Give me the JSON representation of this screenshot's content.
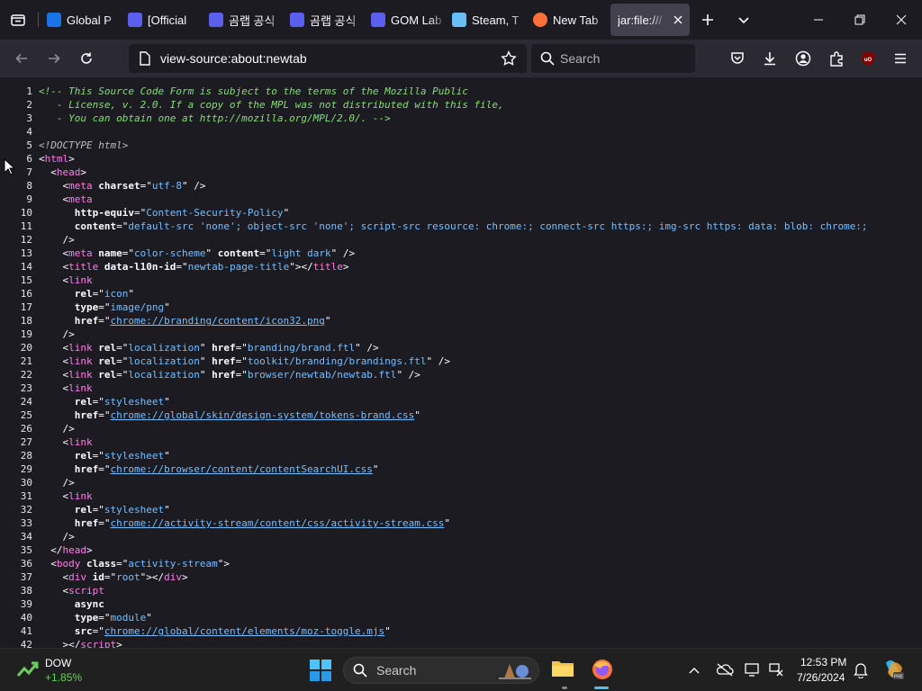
{
  "tabs": [
    {
      "title": "Global P",
      "icon": "edge-icon",
      "color": "#1a73e8"
    },
    {
      "title": "[Official",
      "icon": "gomlab-icon",
      "color": "#5b5fef"
    },
    {
      "title": "곰랩 공식",
      "icon": "gomlab-icon",
      "color": "#5b5fef"
    },
    {
      "title": "곰랩 공식",
      "icon": "gomlab-icon",
      "color": "#5b5fef"
    },
    {
      "title": "GOM Lab",
      "icon": "gomlab-icon",
      "color": "#5b5fef"
    },
    {
      "title": "Steam, T",
      "icon": "steam-icon",
      "color": "#66c0f4"
    },
    {
      "title": "New Tab",
      "icon": "firefox-icon",
      "color": "#ff7139"
    },
    {
      "title": "jar:file:///",
      "icon": "",
      "active": true
    }
  ],
  "nav": {
    "url": "view-source:about:newtab",
    "search_placeholder": "Search"
  },
  "source_lines": [
    [
      [
        "cm",
        "<!-- This Source Code Form is subject to the terms of the Mozilla Public"
      ]
    ],
    [
      [
        "cm",
        "   - License, v. 2.0. If a copy of the MPL was not distributed with this file,"
      ]
    ],
    [
      [
        "cm",
        "   - You can obtain one at http://mozilla.org/MPL/2.0/. -->"
      ]
    ],
    [],
    [
      [
        "dt",
        "<!DOCTYPE html>"
      ]
    ],
    [
      [
        "tx",
        "<"
      ],
      [
        "tg",
        "html"
      ],
      [
        "tx",
        ">"
      ]
    ],
    [
      [
        "tx",
        "  <"
      ],
      [
        "tg",
        "head"
      ],
      [
        "tx",
        ">"
      ]
    ],
    [
      [
        "tx",
        "    <"
      ],
      [
        "tg",
        "meta"
      ],
      [
        "tx",
        " "
      ],
      [
        "at",
        "charset"
      ],
      [
        "tx",
        "=\""
      ],
      [
        "av",
        "utf-8"
      ],
      [
        "tx",
        "\" />"
      ]
    ],
    [
      [
        "tx",
        "    <"
      ],
      [
        "tg",
        "meta"
      ]
    ],
    [
      [
        "tx",
        "      "
      ],
      [
        "at",
        "http-equiv"
      ],
      [
        "tx",
        "=\""
      ],
      [
        "av",
        "Content-Security-Policy"
      ],
      [
        "tx",
        "\""
      ]
    ],
    [
      [
        "tx",
        "      "
      ],
      [
        "at",
        "content"
      ],
      [
        "tx",
        "=\""
      ],
      [
        "av",
        "default-src 'none'; object-src 'none'; script-src resource: chrome:; connect-src https:; img-src https: data: blob: chrome:;"
      ]
    ],
    [
      [
        "tx",
        "    />"
      ]
    ],
    [
      [
        "tx",
        "    <"
      ],
      [
        "tg",
        "meta"
      ],
      [
        "tx",
        " "
      ],
      [
        "at",
        "name"
      ],
      [
        "tx",
        "=\""
      ],
      [
        "av",
        "color-scheme"
      ],
      [
        "tx",
        "\" "
      ],
      [
        "at",
        "content"
      ],
      [
        "tx",
        "=\""
      ],
      [
        "av",
        "light dark"
      ],
      [
        "tx",
        "\" />"
      ]
    ],
    [
      [
        "tx",
        "    <"
      ],
      [
        "tg",
        "title"
      ],
      [
        "tx",
        " "
      ],
      [
        "at",
        "data-l10n-id"
      ],
      [
        "tx",
        "=\""
      ],
      [
        "av",
        "newtab-page-title"
      ],
      [
        "tx",
        "\"></"
      ],
      [
        "tg",
        "title"
      ],
      [
        "tx",
        ">"
      ]
    ],
    [
      [
        "tx",
        "    <"
      ],
      [
        "tg",
        "link"
      ]
    ],
    [
      [
        "tx",
        "      "
      ],
      [
        "at",
        "rel"
      ],
      [
        "tx",
        "=\""
      ],
      [
        "av",
        "icon"
      ],
      [
        "tx",
        "\""
      ]
    ],
    [
      [
        "tx",
        "      "
      ],
      [
        "at",
        "type"
      ],
      [
        "tx",
        "=\""
      ],
      [
        "av",
        "image/png"
      ],
      [
        "tx",
        "\""
      ]
    ],
    [
      [
        "tx",
        "      "
      ],
      [
        "at",
        "href"
      ],
      [
        "tx",
        "=\""
      ],
      [
        "lk",
        "chrome://branding/content/icon32.png"
      ],
      [
        "tx",
        "\""
      ]
    ],
    [
      [
        "tx",
        "    />"
      ]
    ],
    [
      [
        "tx",
        "    <"
      ],
      [
        "tg",
        "link"
      ],
      [
        "tx",
        " "
      ],
      [
        "at",
        "rel"
      ],
      [
        "tx",
        "=\""
      ],
      [
        "av",
        "localization"
      ],
      [
        "tx",
        "\" "
      ],
      [
        "at",
        "href"
      ],
      [
        "tx",
        "=\""
      ],
      [
        "av",
        "branding/brand.ftl"
      ],
      [
        "tx",
        "\" />"
      ]
    ],
    [
      [
        "tx",
        "    <"
      ],
      [
        "tg",
        "link"
      ],
      [
        "tx",
        " "
      ],
      [
        "at",
        "rel"
      ],
      [
        "tx",
        "=\""
      ],
      [
        "av",
        "localization"
      ],
      [
        "tx",
        "\" "
      ],
      [
        "at",
        "href"
      ],
      [
        "tx",
        "=\""
      ],
      [
        "av",
        "toolkit/branding/brandings.ftl"
      ],
      [
        "tx",
        "\" />"
      ]
    ],
    [
      [
        "tx",
        "    <"
      ],
      [
        "tg",
        "link"
      ],
      [
        "tx",
        " "
      ],
      [
        "at",
        "rel"
      ],
      [
        "tx",
        "=\""
      ],
      [
        "av",
        "localization"
      ],
      [
        "tx",
        "\" "
      ],
      [
        "at",
        "href"
      ],
      [
        "tx",
        "=\""
      ],
      [
        "av",
        "browser/newtab/newtab.ftl"
      ],
      [
        "tx",
        "\" />"
      ]
    ],
    [
      [
        "tx",
        "    <"
      ],
      [
        "tg",
        "link"
      ]
    ],
    [
      [
        "tx",
        "      "
      ],
      [
        "at",
        "rel"
      ],
      [
        "tx",
        "=\""
      ],
      [
        "av",
        "stylesheet"
      ],
      [
        "tx",
        "\""
      ]
    ],
    [
      [
        "tx",
        "      "
      ],
      [
        "at",
        "href"
      ],
      [
        "tx",
        "=\""
      ],
      [
        "lk",
        "chrome://global/skin/design-system/tokens-brand.css"
      ],
      [
        "tx",
        "\""
      ]
    ],
    [
      [
        "tx",
        "    />"
      ]
    ],
    [
      [
        "tx",
        "    <"
      ],
      [
        "tg",
        "link"
      ]
    ],
    [
      [
        "tx",
        "      "
      ],
      [
        "at",
        "rel"
      ],
      [
        "tx",
        "=\""
      ],
      [
        "av",
        "stylesheet"
      ],
      [
        "tx",
        "\""
      ]
    ],
    [
      [
        "tx",
        "      "
      ],
      [
        "at",
        "href"
      ],
      [
        "tx",
        "=\""
      ],
      [
        "lk",
        "chrome://browser/content/contentSearchUI.css"
      ],
      [
        "tx",
        "\""
      ]
    ],
    [
      [
        "tx",
        "    />"
      ]
    ],
    [
      [
        "tx",
        "    <"
      ],
      [
        "tg",
        "link"
      ]
    ],
    [
      [
        "tx",
        "      "
      ],
      [
        "at",
        "rel"
      ],
      [
        "tx",
        "=\""
      ],
      [
        "av",
        "stylesheet"
      ],
      [
        "tx",
        "\""
      ]
    ],
    [
      [
        "tx",
        "      "
      ],
      [
        "at",
        "href"
      ],
      [
        "tx",
        "=\""
      ],
      [
        "lk",
        "chrome://activity-stream/content/css/activity-stream.css"
      ],
      [
        "tx",
        "\""
      ]
    ],
    [
      [
        "tx",
        "    />"
      ]
    ],
    [
      [
        "tx",
        "  </"
      ],
      [
        "tg",
        "head"
      ],
      [
        "tx",
        ">"
      ]
    ],
    [
      [
        "tx",
        "  <"
      ],
      [
        "tg",
        "body"
      ],
      [
        "tx",
        " "
      ],
      [
        "at",
        "class"
      ],
      [
        "tx",
        "=\""
      ],
      [
        "av",
        "activity-stream"
      ],
      [
        "tx",
        "\">"
      ]
    ],
    [
      [
        "tx",
        "    <"
      ],
      [
        "tg",
        "div"
      ],
      [
        "tx",
        " "
      ],
      [
        "at",
        "id"
      ],
      [
        "tx",
        "=\""
      ],
      [
        "av",
        "root"
      ],
      [
        "tx",
        "\"></"
      ],
      [
        "tg",
        "div"
      ],
      [
        "tx",
        ">"
      ]
    ],
    [
      [
        "tx",
        "    <"
      ],
      [
        "tg",
        "script"
      ]
    ],
    [
      [
        "tx",
        "      "
      ],
      [
        "at",
        "async"
      ]
    ],
    [
      [
        "tx",
        "      "
      ],
      [
        "at",
        "type"
      ],
      [
        "tx",
        "=\""
      ],
      [
        "av",
        "module"
      ],
      [
        "tx",
        "\""
      ]
    ],
    [
      [
        "tx",
        "      "
      ],
      [
        "at",
        "src"
      ],
      [
        "tx",
        "=\""
      ],
      [
        "lk",
        "chrome://global/content/elements/moz-toggle.mjs"
      ],
      [
        "tx",
        "\""
      ]
    ],
    [
      [
        "tx",
        "    ></"
      ],
      [
        "tg",
        "script"
      ],
      [
        "tx",
        ">"
      ]
    ]
  ],
  "taskbar": {
    "stock_name": "DOW",
    "stock_change": "+1.85%",
    "search_placeholder": "Search",
    "time": "12:53 PM",
    "date": "7/26/2024",
    "colors": {
      "stock_up": "#6ccb5f"
    }
  }
}
